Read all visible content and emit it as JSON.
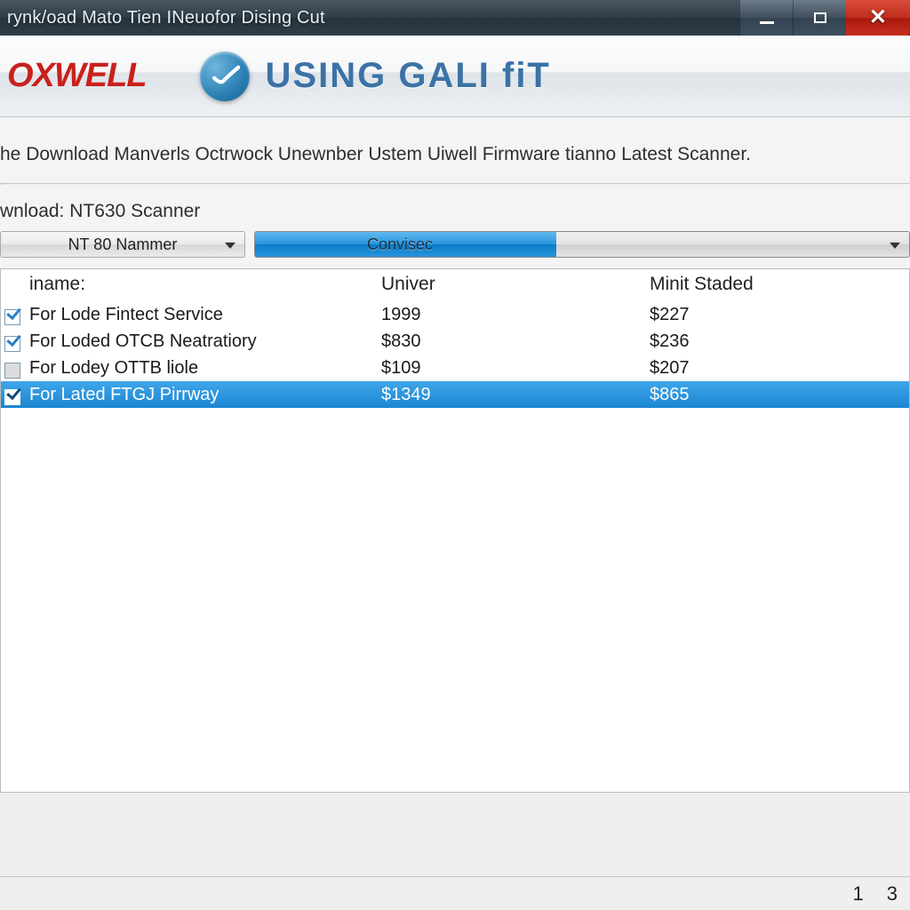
{
  "titlebar": {
    "text": "rynk/oad Mato Tien INeuofor Dising Cut"
  },
  "header": {
    "brand": "OXWELL",
    "app_title": "USING GALI fiT",
    "icon_name": "swoosh-check-icon"
  },
  "description": "he Download Manverls Octrwock Unewnber Ustem Uiwell Firmware tianno Latest Scanner.",
  "download": {
    "label": "wnload: NT630 Scanner",
    "model_select": "NT 80 Nammer",
    "action_select": "Convisec"
  },
  "table": {
    "headers": {
      "name": "iname:",
      "univer": "Univer",
      "minit": "Minit Staded"
    },
    "rows": [
      {
        "checked": true,
        "grayed": false,
        "name": "For Lode Fintect Service",
        "univer": "1999",
        "minit": "$227",
        "selected": false
      },
      {
        "checked": true,
        "grayed": false,
        "name": "For Loded OTCB Neatratiory",
        "univer": "$830",
        "minit": "$236",
        "selected": false
      },
      {
        "checked": false,
        "grayed": true,
        "name": "For Lodey OTTB liole",
        "univer": "$109",
        "minit": "$207",
        "selected": false
      },
      {
        "checked": true,
        "grayed": false,
        "name": "For Lated FTGJ Pirrway",
        "univer": "$1349",
        "minit": "$865",
        "selected": true
      }
    ]
  },
  "status": {
    "left": "1",
    "right": "3"
  }
}
